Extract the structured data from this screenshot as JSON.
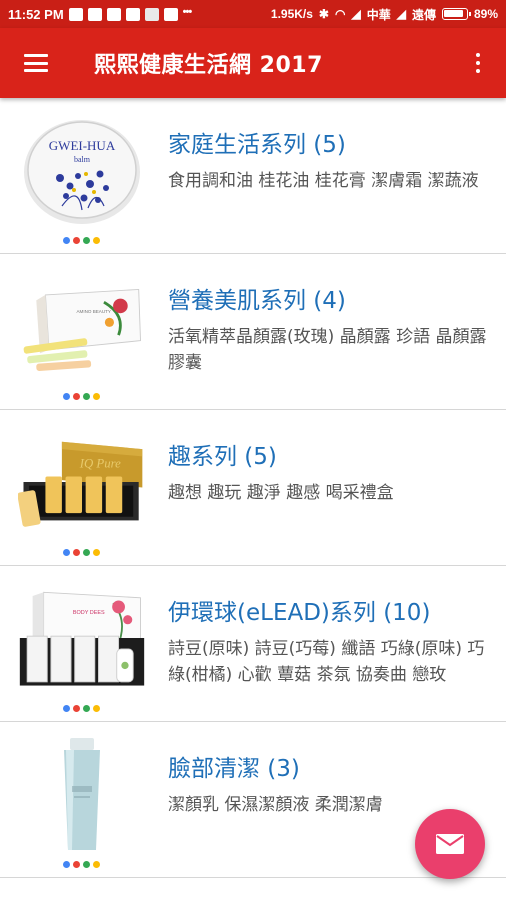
{
  "status_bar": {
    "time": "11:52 PM",
    "speed": "1.95K/s",
    "carrier1": "中華",
    "carrier2": "遠傳",
    "battery": "89%"
  },
  "toolbar": {
    "title": "熙熙健康生活網 2017",
    "menu_icon": "hamburger-menu-icon",
    "overflow_icon": "more-vert-icon"
  },
  "dot_colors": [
    "#4285f4",
    "#ea4335",
    "#34a853",
    "#fbbc05"
  ],
  "categories": [
    {
      "title": "家庭生活系列 (5)",
      "subtitle": "食用調和油 桂花油 桂花膏 潔膚霜 潔蔬液",
      "image": "gwei-hua-balm-tin"
    },
    {
      "title": "營養美肌系列 (4)",
      "subtitle": "活氧精萃晶顏露(玫瑰) 晶顏露 珍語 晶顏露膠囊",
      "image": "beauty-gift-box"
    },
    {
      "title": "趣系列 (5)",
      "subtitle": "趣想 趣玩 趣淨 趣感 喝采禮盒",
      "image": "gold-gift-box"
    },
    {
      "title": "伊環球(eLEAD)系列 (10)",
      "subtitle": "詩豆(原味) 詩豆(巧莓) 纖語 巧綠(原味) 巧綠(柑橘) 心歡 蕈菇 茶氛 協奏曲 戀玫",
      "image": "eLEAD-box-set"
    },
    {
      "title": "臉部清潔 (3)",
      "subtitle": "潔顏乳 保濕潔顏液 柔潤潔膚",
      "image": "cleanser-tube"
    }
  ],
  "fab": {
    "icon": "mail-icon"
  }
}
